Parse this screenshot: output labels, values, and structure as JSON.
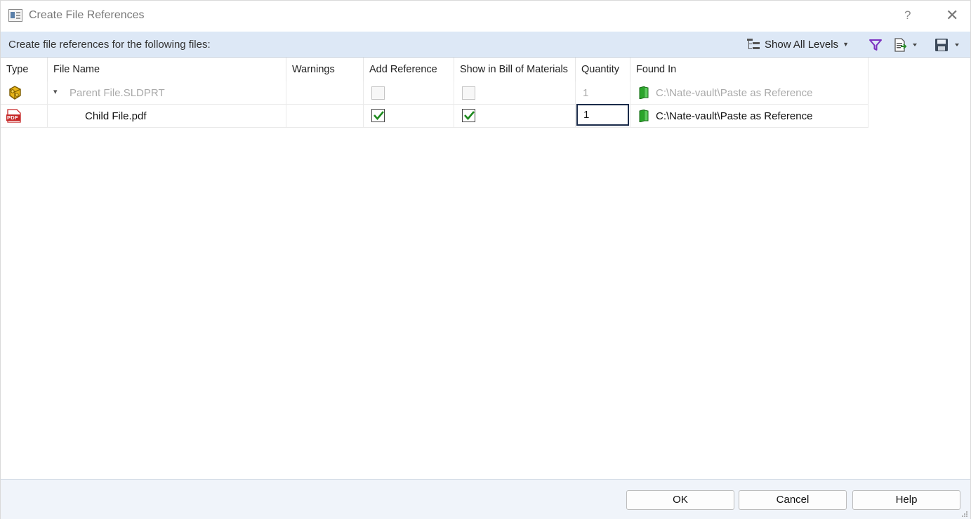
{
  "window": {
    "title": "Create File References",
    "help_glyph": "?",
    "close_glyph": "✕"
  },
  "toolbar": {
    "label": "Create file references for the following files:",
    "levels_label": "Show All Levels"
  },
  "columns": [
    "Type",
    "File Name",
    "Warnings",
    "Add Reference",
    "Show in Bill of Materials",
    "Quantity",
    "Found In"
  ],
  "rows": [
    {
      "type_icon": "part-file-icon",
      "expand_glyph": "▾",
      "file_name": "Parent File.SLDPRT",
      "warnings": "",
      "add_reference": false,
      "show_in_bom": false,
      "quantity": "1",
      "found_in": "C:\\Nate-vault\\Paste as Reference",
      "disabled": true
    },
    {
      "type_icon": "pdf-file-icon",
      "type_icon_text": "PDF",
      "file_name": "Child File.pdf",
      "warnings": "",
      "add_reference": true,
      "show_in_bom": true,
      "quantity": "1",
      "found_in": "C:\\Nate-vault\\Paste as Reference",
      "disabled": false
    }
  ],
  "buttons": {
    "ok": "OK",
    "cancel": "Cancel",
    "help": "Help"
  },
  "colors": {
    "toolbar_bg": "#dde8f6",
    "vault_green": "#2aa52a",
    "filter_purple": "#7b2fbf",
    "pdf_red": "#c62828"
  }
}
